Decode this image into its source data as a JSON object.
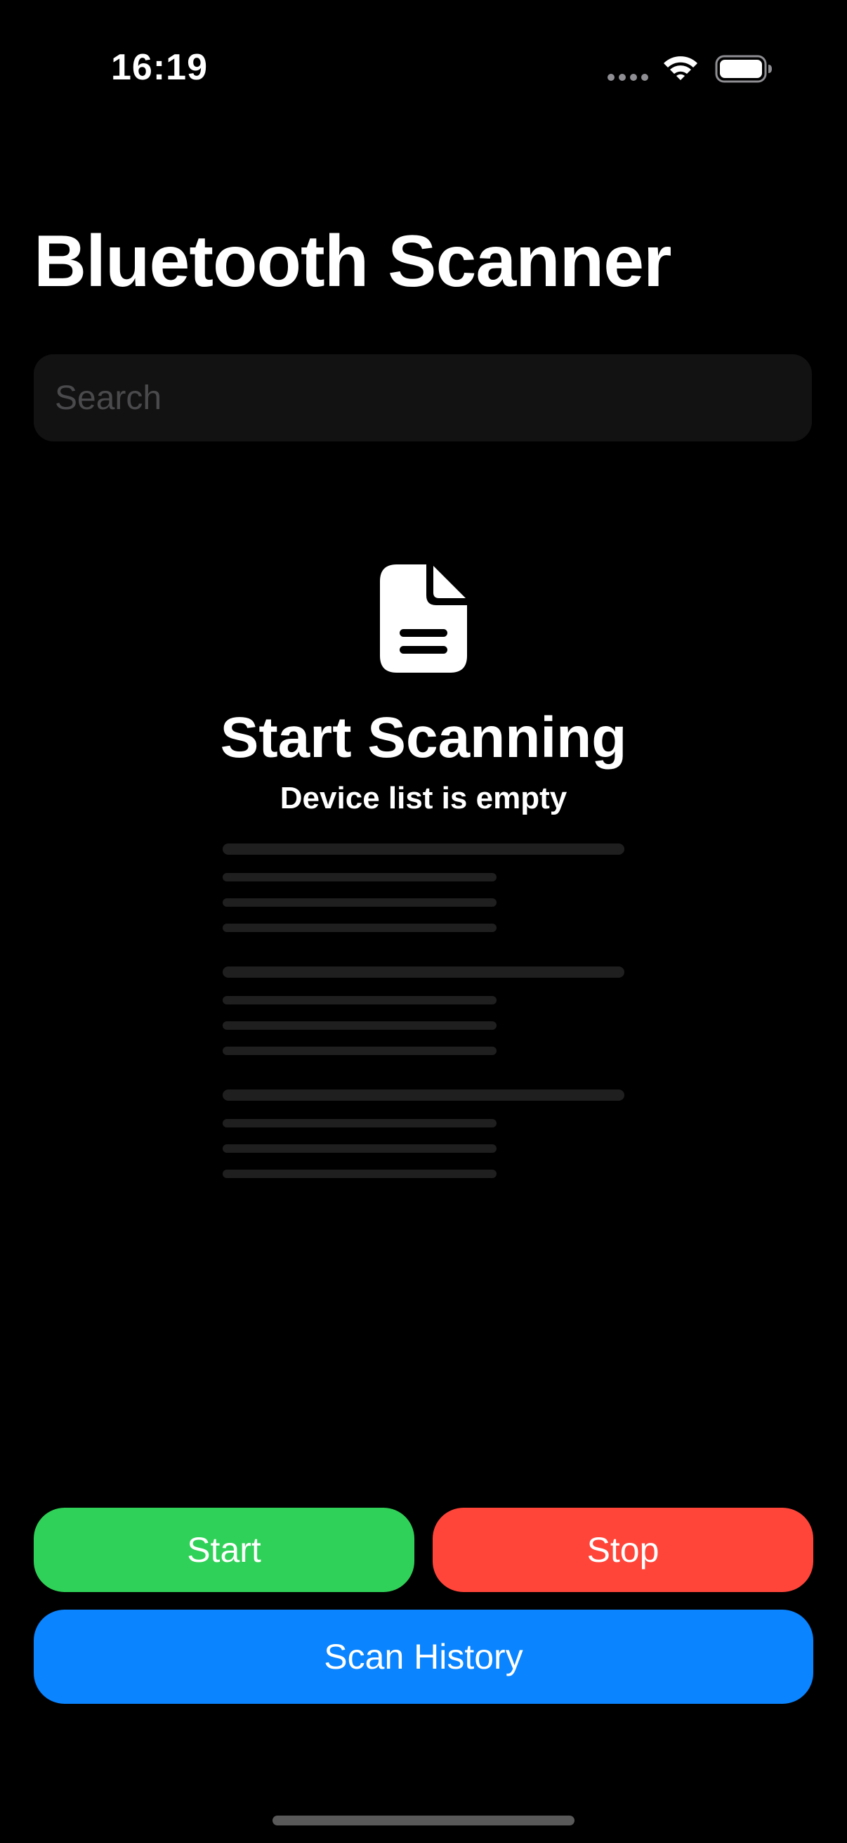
{
  "status_bar": {
    "time": "16:19",
    "signal_icon": "cellular-signal-dots-icon",
    "wifi_icon": "wifi-icon",
    "battery_icon": "battery-icon"
  },
  "header": {
    "title": "Bluetooth Scanner"
  },
  "search": {
    "placeholder": "Search",
    "value": ""
  },
  "empty_state": {
    "icon": "document-icon",
    "title": "Start Scanning",
    "subtitle": "Device list is empty"
  },
  "actions": {
    "start_label": "Start",
    "stop_label": "Stop",
    "history_label": "Scan History"
  },
  "colors": {
    "background": "#000000",
    "start": "#30d158",
    "stop": "#ff453a",
    "history": "#0a84ff",
    "search_field": "#121212",
    "placeholder": "#4a4a4d",
    "skeleton": "#1f1f1f"
  }
}
